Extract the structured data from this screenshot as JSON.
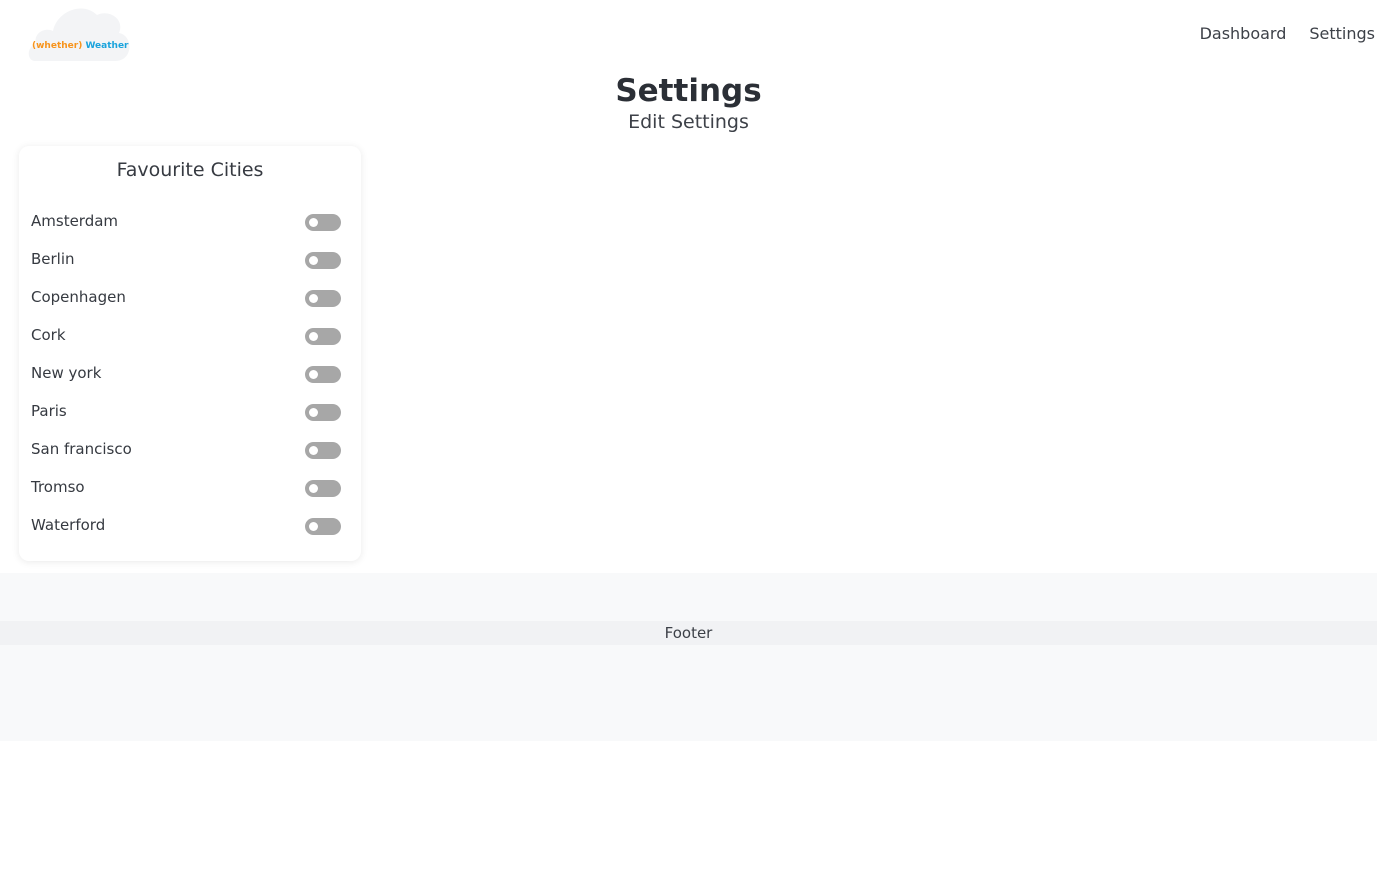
{
  "logo": {
    "part1": "(whether)",
    "part2": "Weather"
  },
  "nav": {
    "dashboard": "Dashboard",
    "settings": "Settings"
  },
  "page": {
    "title": "Settings",
    "subtitle": "Edit Settings"
  },
  "card": {
    "title": "Favourite Cities",
    "cities": [
      {
        "name": "Amsterdam",
        "enabled": false
      },
      {
        "name": "Berlin",
        "enabled": false
      },
      {
        "name": "Copenhagen",
        "enabled": false
      },
      {
        "name": "Cork",
        "enabled": false
      },
      {
        "name": "New york",
        "enabled": false
      },
      {
        "name": "Paris",
        "enabled": false
      },
      {
        "name": "San francisco",
        "enabled": false
      },
      {
        "name": "Tromso",
        "enabled": false
      },
      {
        "name": "Waterford",
        "enabled": false
      }
    ]
  },
  "footer": {
    "label": "Footer"
  },
  "colors": {
    "logo_orange": "#f7941d",
    "logo_blue": "#1aa3dc",
    "toggle_off": "#a7a7a7",
    "footer_bg": "#f8f9fa"
  }
}
